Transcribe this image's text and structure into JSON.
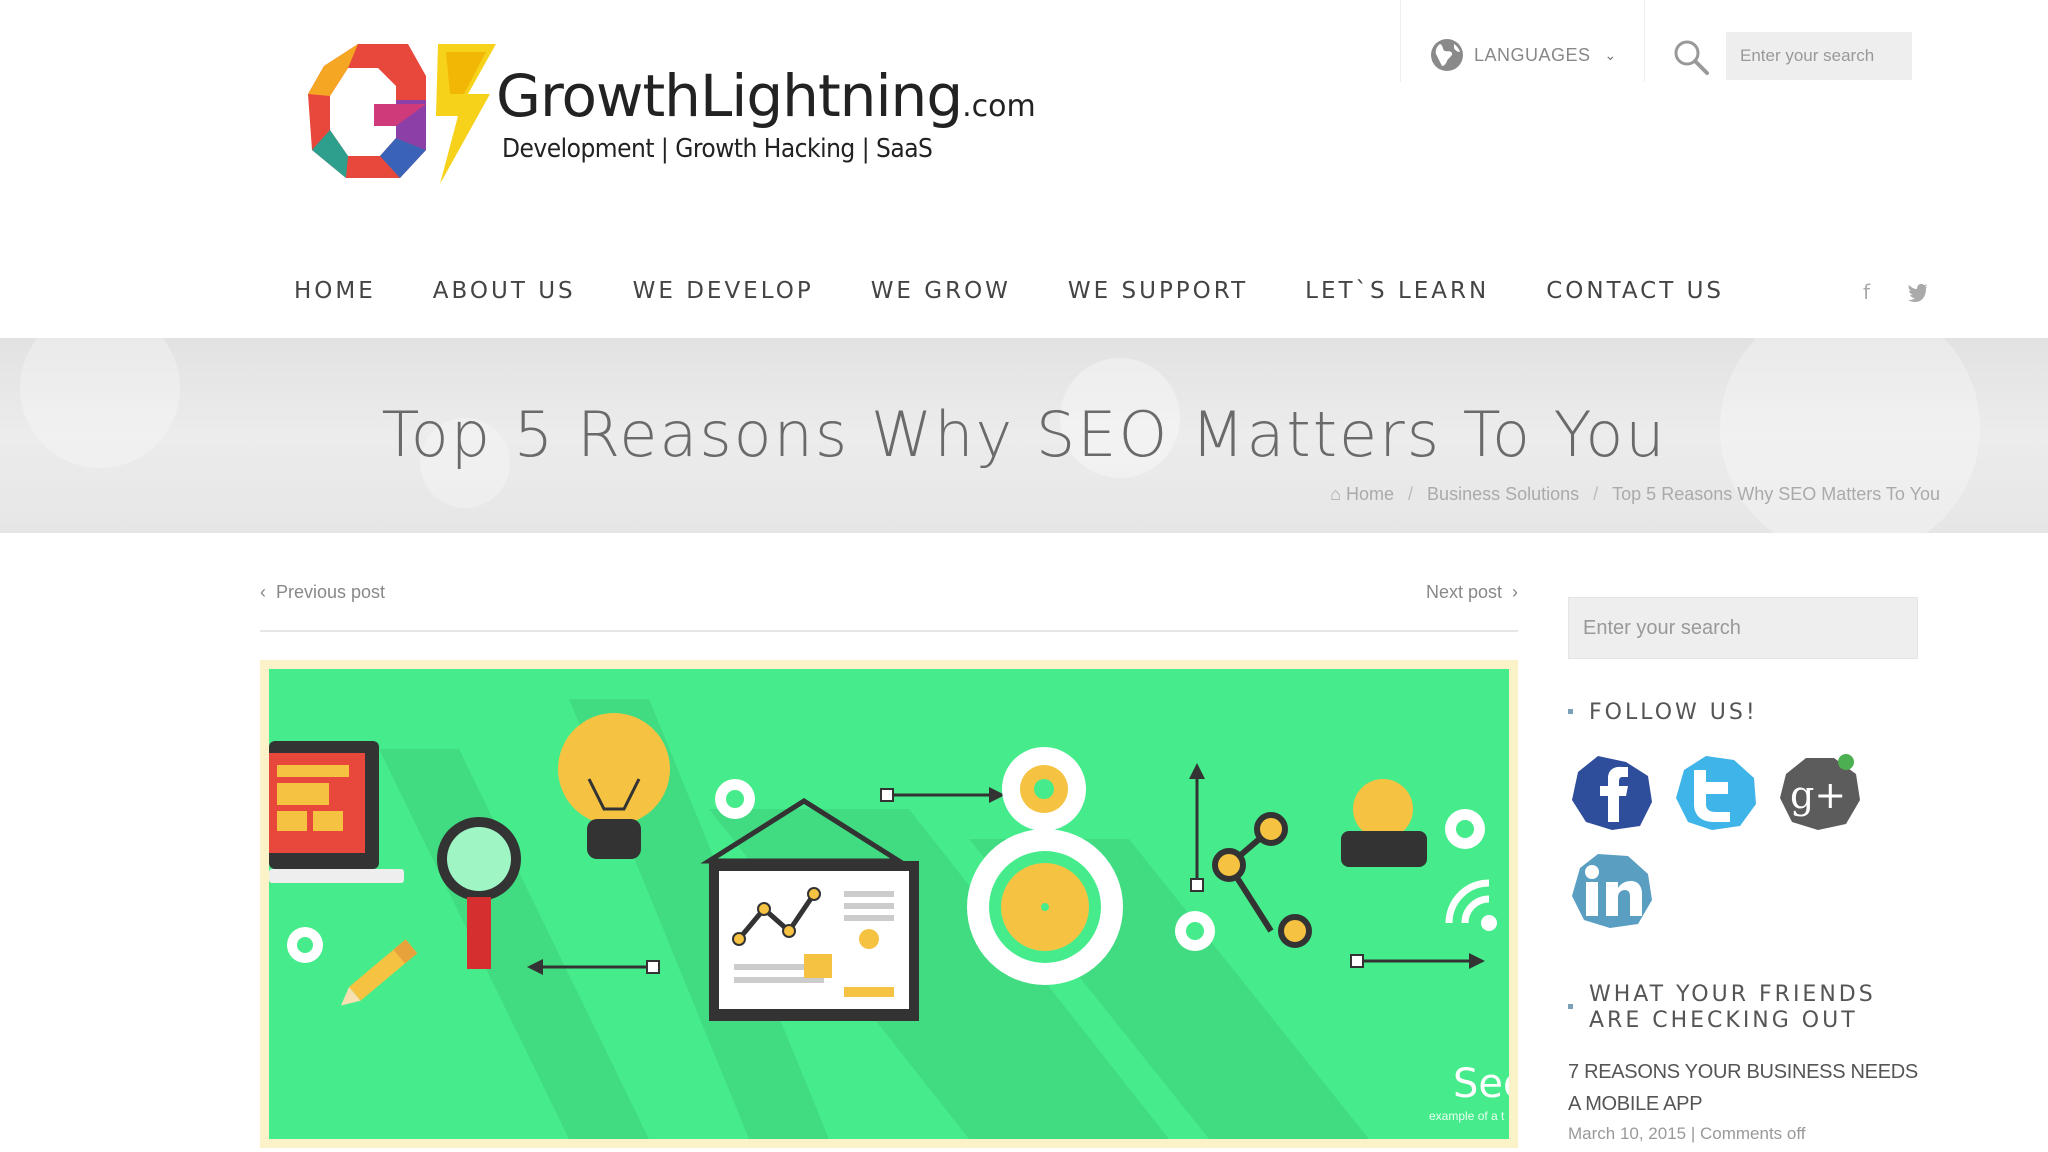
{
  "logo": {
    "name": "GrowthLightning",
    "suffix": ".com",
    "tagline": "Development | Growth Hacking | SaaS"
  },
  "top": {
    "languages_label": "LANGUAGES",
    "search_placeholder": "Enter your search"
  },
  "nav": {
    "items": [
      "HOME",
      "ABOUT US",
      "WE DEVELOP",
      "WE GROW",
      "WE SUPPORT",
      "LET`S LEARN",
      "CONTACT US"
    ],
    "social": [
      "f",
      "t"
    ]
  },
  "banner": {
    "title": "Top 5 Reasons Why SEO Matters To You",
    "breadcrumb": [
      "Home",
      "Business Solutions",
      "Top 5 Reasons Why SEO Matters To You"
    ]
  },
  "post_nav": {
    "previous": "Previous post",
    "next": "Next post"
  },
  "hero": {
    "caption": "Seo",
    "subcaption": "example of a t"
  },
  "sidebar": {
    "search_placeholder": "Enter your search",
    "follow_title": "FOLLOW US!",
    "friends_title_line1": "WHAT YOUR FRIENDS",
    "friends_title_line2": "ARE CHECKING OUT",
    "friend_post_title": "7 REASONS YOUR BUSINESS NEEDS A MOBILE APP",
    "friend_post_meta": "March 10, 2015 | Comments off"
  },
  "colors": {
    "hero_green": "#46ec8b",
    "hero_border": "#fbf2c8",
    "banner_bg": "#e6e6e6"
  }
}
